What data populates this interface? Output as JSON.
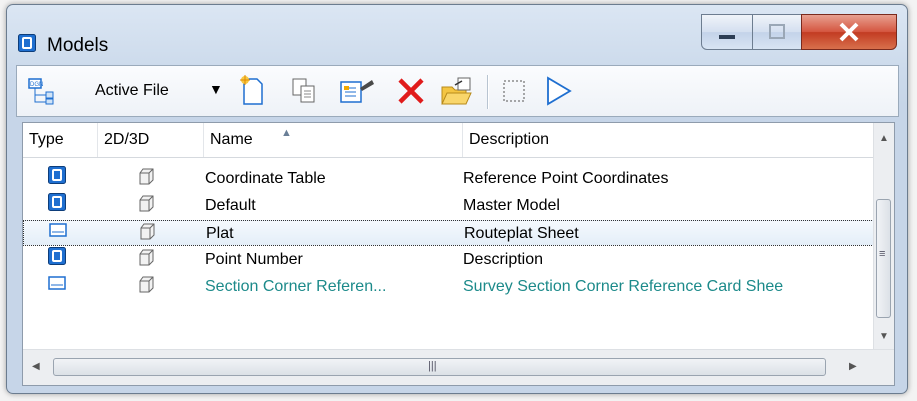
{
  "window": {
    "title": "Models",
    "icon": "model-icon"
  },
  "title_controls": {
    "minimize": "minimize-icon",
    "maximize": "maximize-icon",
    "close": "close-icon"
  },
  "toolbar": {
    "active_file_label": "Active File",
    "dropdown_icon": "chevron-down-icon",
    "buttons": [
      "new-model-icon",
      "copy-model-icon",
      "properties-icon",
      "delete-icon",
      "import-icon",
      "select-all-icon",
      "open-sheet-icon"
    ]
  },
  "table": {
    "columns": {
      "type": "Type",
      "dimension": "2D/3D",
      "name": "Name",
      "description": "Description"
    },
    "sort_icon": "sort-ascending-icon",
    "rows": [
      {
        "type_icon": "design-model-icon",
        "dim_icon": "3d-cube-icon",
        "name": "Coordinate Table",
        "description": "Reference Point Coordinates"
      },
      {
        "type_icon": "design-model-icon",
        "dim_icon": "3d-cube-icon",
        "name": "Default",
        "description": "Master Model"
      },
      {
        "type_icon": "sheet-model-icon",
        "dim_icon": "3d-cube-icon",
        "name": "Plat",
        "description": "Routeplat Sheet",
        "selected": true
      },
      {
        "type_icon": "design-model-icon",
        "dim_icon": "3d-cube-icon",
        "name": "Point Number",
        "description": "Description"
      },
      {
        "type_icon": "sheet-model-icon",
        "dim_icon": "3d-cube-icon",
        "name": "Section Corner Referen...",
        "description": "Survey Section Corner Reference Card Shee"
      }
    ]
  },
  "scrollbar_grip": "|||",
  "scrollbar_vgrip": "≡",
  "colors": {
    "accent": "#1f6fd0",
    "teal_text": "#1c8a8a",
    "close_red": "#c23b22"
  }
}
